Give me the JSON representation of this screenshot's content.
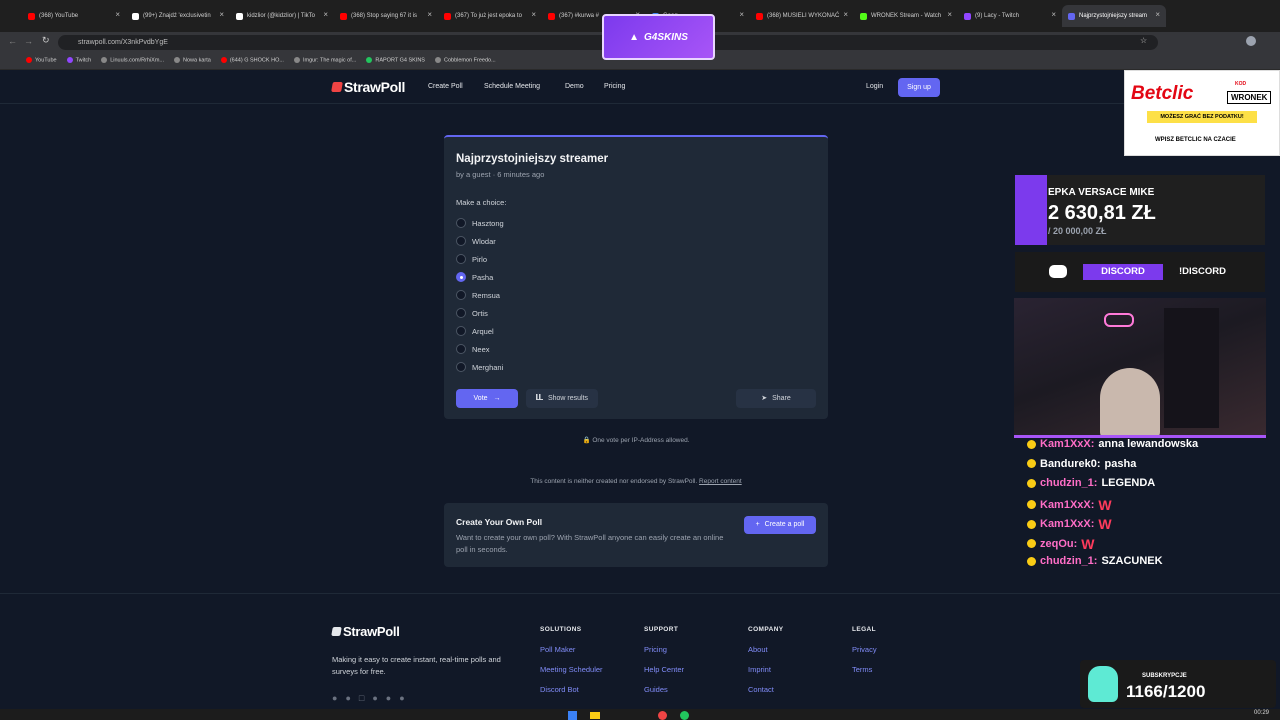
{
  "browser": {
    "tabs": [
      {
        "label": "(368) YouTube",
        "color": "#ff0000"
      },
      {
        "label": "(99+) Znajdź 'exclusivetin",
        "color": "#ffffff"
      },
      {
        "label": "kidzlior (@kidzlior) | TikTo",
        "color": "#ffffff"
      },
      {
        "label": "(368) Stop saying 67 it is",
        "color": "#ff0000"
      },
      {
        "label": "(367) To już jest epoka to",
        "color": "#ff0000"
      },
      {
        "label": "(367) #kurwa #",
        "color": "#ff0000"
      },
      {
        "label": "Goog",
        "color": "#4285f4"
      },
      {
        "label": "(368) MUSIELI WYKONAĆ",
        "color": "#ff0000"
      },
      {
        "label": "WRONEK Stream - Watch",
        "color": "#53fc18"
      },
      {
        "label": "(9) Lacy - Twitch",
        "color": "#9146ff"
      },
      {
        "label": "Najprzystojniejszy stream",
        "color": "#6366f1"
      }
    ],
    "url": "strawpoll.com/X3nkPvdbYgE",
    "bookmarks": [
      "YouTube",
      "Twitch",
      "Linuuls.com/RrhiXm...",
      "Nowa karta",
      "(644) G SHOCK HO...",
      "Imgur: The magic of...",
      "RAPORT G4 SKINS",
      "Cobblemon Freedo..."
    ]
  },
  "nav": {
    "logo": "StrawPoll",
    "links": [
      "Create Poll",
      "Schedule Meeting",
      "Demo",
      "Pricing"
    ],
    "login": "Login",
    "signup": "Sign up"
  },
  "poll": {
    "title": "Najprzystojniejszy streamer",
    "meta": "by a guest · 6 minutes ago",
    "prompt": "Make a choice:",
    "options": [
      {
        "label": "Hasztong",
        "checked": false
      },
      {
        "label": "Wlodar",
        "checked": false
      },
      {
        "label": "Pirlo",
        "checked": false
      },
      {
        "label": "Pasha",
        "checked": true
      },
      {
        "label": "Remsua",
        "checked": false
      },
      {
        "label": "Ortis",
        "checked": false
      },
      {
        "label": "Arquel",
        "checked": false
      },
      {
        "label": "Neex",
        "checked": false
      },
      {
        "label": "Merghani",
        "checked": false
      }
    ],
    "vote_label": "Vote",
    "show_results_label": "Show results",
    "share_label": "Share",
    "ip_note": "One vote per IP-Address allowed."
  },
  "disclaimer": {
    "text": "This content is neither created nor endorsed by StrawPoll.",
    "report": "Report content"
  },
  "create_own": {
    "title": "Create Your Own Poll",
    "desc": "Want to create your own poll? With StrawPoll anyone can easily create an online poll in seconds.",
    "button": "Create a poll"
  },
  "footer": {
    "logo": "StrawPoll",
    "tagline": "Making it easy to create instant, real-time polls and surveys for free.",
    "columns": [
      {
        "head": "SOLUTIONS",
        "links": [
          "Poll Maker",
          "Meeting Scheduler",
          "Discord Bot"
        ]
      },
      {
        "head": "SUPPORT",
        "links": [
          "Pricing",
          "Help Center",
          "Guides"
        ]
      },
      {
        "head": "COMPANY",
        "links": [
          "About",
          "Imprint",
          "Contact"
        ]
      },
      {
        "head": "LEGAL",
        "links": [
          "Privacy",
          "Terms"
        ]
      }
    ]
  },
  "stream_overlay": {
    "g4skins": "G4SKINS",
    "betclic": {
      "brand": "Betclic",
      "code_label": "KOD",
      "code": "WRONEK",
      "tagline": "MOŻESZ GRAĆ BEZ PODATKU!",
      "cta": "WPISZ BETCLIC NA CZACIE"
    },
    "donation": {
      "name": "EPKA VERSACE MIKE",
      "amount": "2 630,81 ZŁ",
      "goal": "/ 20 000,00 ZŁ"
    },
    "discord": {
      "label": "DISCORD",
      "command": "!DISCORD"
    },
    "chat": [
      {
        "user": "Kam1XxX:",
        "msg": "anna lewandowska",
        "color": "#ff6ec7"
      },
      {
        "user": "Bandurek0:",
        "msg": "pasha",
        "color": "#ffffff"
      },
      {
        "user": "chudzin_1:",
        "msg": "LEGENDA",
        "color": "#ff6ec7"
      },
      {
        "user": "Kam1XxX:",
        "msg": "W",
        "color": "#ff6ec7"
      },
      {
        "user": "Kam1XxX:",
        "msg": "W",
        "color": "#ff6ec7"
      },
      {
        "user": "zeqOu:",
        "msg": "W",
        "color": "#ff6ec7"
      },
      {
        "user": "chudzin_1:",
        "msg": "SZACUNEK",
        "color": "#ff6ec7"
      }
    ],
    "subs": {
      "label": "SUBSKRYPCJE",
      "value": "1166/1200"
    }
  },
  "taskbar": {
    "time": "00:29"
  }
}
